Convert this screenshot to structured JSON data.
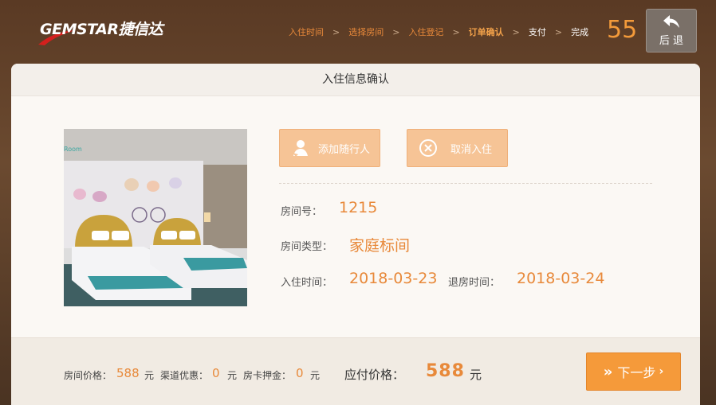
{
  "brand": {
    "logo_text": "GEMSTAR捷信达"
  },
  "steps": [
    {
      "label": "入住时间",
      "state": "done"
    },
    {
      "label": "选择房间",
      "state": "done"
    },
    {
      "label": "入住登记",
      "state": "done"
    },
    {
      "label": "订单确认",
      "state": "current"
    },
    {
      "label": "支付",
      "state": "future"
    },
    {
      "label": "完成",
      "state": "future"
    }
  ],
  "step_separator": ">",
  "countdown": "55",
  "back_button": {
    "label": "后 退",
    "icon": "back-arrow-icon"
  },
  "panel": {
    "title": "入住信息确认"
  },
  "photo": {
    "watermark": "Room"
  },
  "actions": {
    "add_companion": {
      "label": "添加随行人",
      "icon": "person-add-icon"
    },
    "cancel_checkin": {
      "label": "取消入住",
      "icon": "circle-x-icon"
    }
  },
  "info": {
    "room_no_label": "房间号：",
    "room_no": "1215",
    "room_type_label": "房间类型：",
    "room_type": "家庭标间",
    "checkin_label": "入住时间：",
    "checkin": "2018-03-23",
    "checkout_label": "退房时间：",
    "checkout": "2018-03-24"
  },
  "footer": {
    "room_price_label": "房间价格：",
    "room_price": "588",
    "channel_discount_label": "渠道优惠：",
    "channel_discount": "0",
    "card_deposit_label": "房卡押金：",
    "card_deposit": "0",
    "currency": "元",
    "amount_due_label": "应付价格：",
    "amount_due": "588",
    "amount_due_unit": "元"
  },
  "next_button": {
    "label": "下一步",
    "icon": "double-chevron-right-icon"
  },
  "colors": {
    "accent": "#f59a3a",
    "accent_text": "#e8893a",
    "button_light": "#f6c496"
  }
}
